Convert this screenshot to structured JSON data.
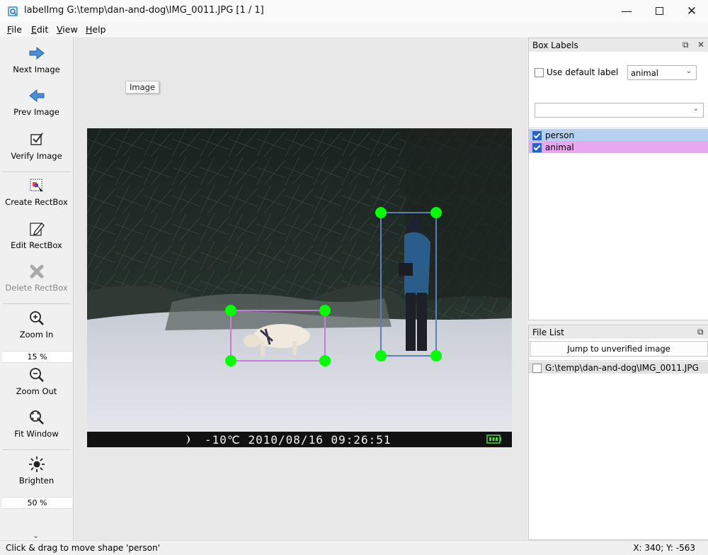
{
  "window": {
    "title": "labelImg G:\\temp\\dan-and-dog\\IMG_0011.JPG [1 / 1]",
    "minimize_icon": "minimize-icon",
    "maximize_icon": "maximize-icon",
    "close_icon": "close-icon"
  },
  "menu": [
    {
      "label": "File",
      "mnemonic": "F",
      "rest": "ile"
    },
    {
      "label": "Edit",
      "mnemonic": "E",
      "rest": "dit"
    },
    {
      "label": "View",
      "mnemonic": "V",
      "rest": "iew"
    },
    {
      "label": "Help",
      "mnemonic": "H",
      "rest": "elp"
    }
  ],
  "toolbar": {
    "next_image": "Next Image",
    "prev_image": "Prev Image",
    "verify_image": "Verify Image",
    "create_rectbox": "Create RectBox",
    "edit_rectbox": "Edit RectBox",
    "delete_rectbox": "Delete RectBox",
    "zoom_in": "Zoom In",
    "zoom_value": "15 %",
    "zoom_out": "Zoom Out",
    "fit_window": "Fit Window",
    "brighten": "Brighten",
    "brightness_value": "50 %"
  },
  "canvas": {
    "tooltip": "Image",
    "osd_text": "-10℃  2010/08/16  09:26:51",
    "shapes": [
      {
        "label": "person",
        "color": "#5b7fb8"
      },
      {
        "label": "animal",
        "color": "#c77ad6"
      }
    ],
    "vertex_color": "#00ff00"
  },
  "box_labels": {
    "title": "Box Labels",
    "use_default_label": "Use default label",
    "use_default_checked": false,
    "default_label_value": "animal",
    "filter_value": "",
    "items": [
      {
        "label": "person",
        "checked": true,
        "bg": "#b8d0f0"
      },
      {
        "label": "animal",
        "checked": true,
        "bg": "#e8a8ee"
      }
    ]
  },
  "file_list": {
    "title": "File List",
    "jump_button": "Jump to unverified image",
    "files": [
      {
        "path": "G:\\temp\\dan-and-dog\\IMG_0011.JPG",
        "checked": false
      }
    ]
  },
  "status": {
    "message": "Click & drag to move shape 'person'",
    "coords": "X: 340; Y: -563"
  }
}
